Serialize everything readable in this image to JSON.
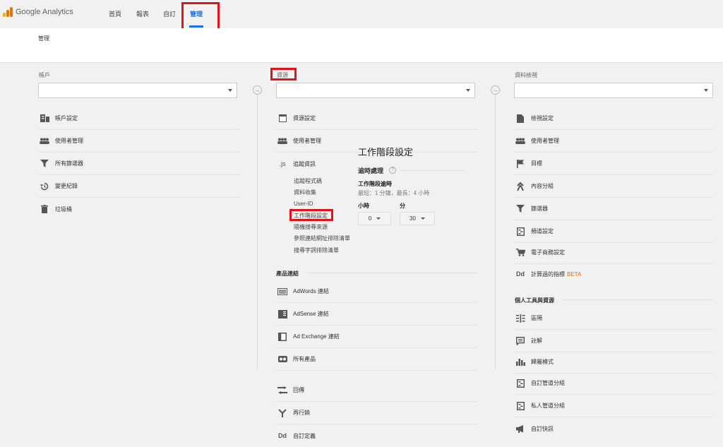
{
  "app": {
    "name": "Google Analytics"
  },
  "nav": {
    "home": "首頁",
    "reports": "報表",
    "custom": "自訂",
    "admin": "管理"
  },
  "breadcrumb": "管理",
  "columns": {
    "account": {
      "label": "帳戶",
      "items": [
        "帳戶設定",
        "使用者管理",
        "所有篩選器",
        "變更紀錄",
        "垃圾桶"
      ]
    },
    "property": {
      "label": "資源",
      "items": [
        "資源設定",
        "使用者管理",
        "追蹤資訊"
      ],
      "tracking_prefix": ".js",
      "tracking_sub": [
        "追蹤程式碼",
        "資料收集",
        "User-ID",
        "工作階段設定",
        "隨機搜尋來源",
        "參照連結網址排除清單",
        "搜尋字詞排除清單"
      ],
      "product_links_heading": "產品連結",
      "product_links": [
        "AdWords 連結",
        "AdSense 連結",
        "Ad Exchange 連結",
        "所有產品"
      ],
      "more": [
        "回傳",
        "再行銷",
        "自訂定義"
      ],
      "dd_icon": "Dd"
    },
    "view": {
      "label": "資料檢視",
      "items": [
        "檢視設定",
        "使用者管理",
        "目標",
        "內容分組",
        "篩選器",
        "頻道設定",
        "電子商務設定",
        "計算過的指標"
      ],
      "beta": "BETA",
      "dd_icon": "Dd",
      "personal_heading": "個人工具與資源",
      "personal": [
        "區隔",
        "註解",
        "歸屬模式",
        "自訂管道分組",
        "私人管道分組",
        "自訂快訊"
      ]
    }
  },
  "session_panel": {
    "title": "工作階段設定",
    "timeout_heading": "逾時處理",
    "help": "?",
    "subheading": "工作階段逾時",
    "hint": "最短：1 分鐘，最長：4 小時",
    "hours_label": "小時",
    "minutes_label": "分",
    "hours_value": "0",
    "minutes_value": "30"
  },
  "colors": {
    "accent": "#1a73e8",
    "highlight": "#e0121b",
    "beta": "#e37400"
  }
}
